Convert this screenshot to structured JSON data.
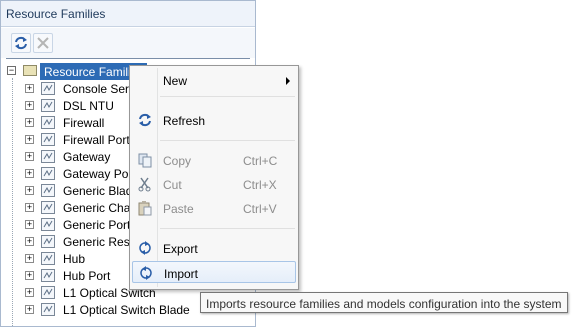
{
  "panel": {
    "title": "Resource Families",
    "toolbar": {
      "refresh_icon": "refresh-icon",
      "delete_icon": "delete-icon"
    }
  },
  "tree": {
    "root_label": "Resource Families",
    "items": [
      {
        "label": "Console Serv"
      },
      {
        "label": "DSL NTU"
      },
      {
        "label": "Firewall"
      },
      {
        "label": "Firewall Port"
      },
      {
        "label": "Gateway"
      },
      {
        "label": "Gateway Por"
      },
      {
        "label": "Generic Blad"
      },
      {
        "label": "Generic Chas"
      },
      {
        "label": "Generic Port"
      },
      {
        "label": "Generic Reso"
      },
      {
        "label": "Hub"
      },
      {
        "label": "Hub Port"
      },
      {
        "label": "L1 Optical Switch"
      },
      {
        "label": "L1 Optical Switch Blade"
      }
    ]
  },
  "context_menu": {
    "new": {
      "label": "New"
    },
    "refresh": {
      "label": "Refresh"
    },
    "copy": {
      "label": "Copy",
      "shortcut": "Ctrl+C"
    },
    "cut": {
      "label": "Cut",
      "shortcut": "Ctrl+X"
    },
    "paste": {
      "label": "Paste",
      "shortcut": "Ctrl+V"
    },
    "export": {
      "label": "Export"
    },
    "import": {
      "label": "Import"
    }
  },
  "tooltip": {
    "text": "Imports resource families and models configuration into the system"
  },
  "colors": {
    "selection": "#2d6bb5",
    "refresh_icon_blue": "#2a5ea8"
  }
}
